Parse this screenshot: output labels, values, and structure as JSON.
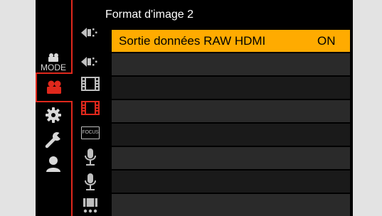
{
  "header": {
    "title": "Format d'image 2"
  },
  "left_column": {
    "mode_label": "MODE",
    "items": [
      {
        "name": "mode-tab",
        "icon": "video-camera-icon"
      },
      {
        "name": "creative-video-tab",
        "icon": "video-camera-icon",
        "active": true
      },
      {
        "name": "custom-tab",
        "icon": "gear-icon"
      },
      {
        "name": "setup-tab",
        "icon": "wrench-icon"
      },
      {
        "name": "my-menu-tab",
        "icon": "person-icon"
      }
    ]
  },
  "sub_column": {
    "focus_label": "FOCUS",
    "items": [
      {
        "icon": "image-quality-icon"
      },
      {
        "icon": "image-quality-icon"
      },
      {
        "icon": "film-icon"
      },
      {
        "icon": "film-icon",
        "active": true
      },
      {
        "icon": "focus-icon"
      },
      {
        "icon": "microphone-icon"
      },
      {
        "icon": "microphone-icon"
      },
      {
        "icon": "video-settings-icon"
      }
    ]
  },
  "menu": {
    "rows": [
      {
        "label": "Sortie données RAW HDMI",
        "value": "ON",
        "selected": true
      },
      {
        "label": "",
        "value": ""
      },
      {
        "label": "",
        "value": ""
      },
      {
        "label": "",
        "value": ""
      },
      {
        "label": "",
        "value": ""
      },
      {
        "label": "",
        "value": ""
      },
      {
        "label": "",
        "value": ""
      },
      {
        "label": "",
        "value": ""
      }
    ]
  },
  "colors": {
    "accent": "#e0281c",
    "highlight": "#ffab00",
    "background": "#000000"
  }
}
